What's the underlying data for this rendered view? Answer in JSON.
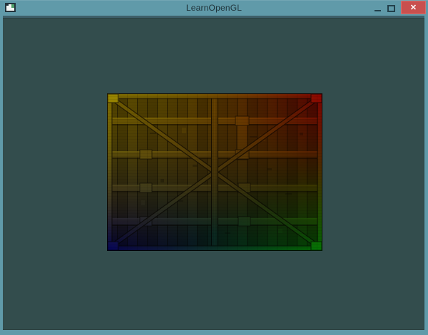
{
  "window": {
    "title": "LearnOpenGL",
    "icons": {
      "app": "app-window-icon",
      "minimize": "minimize-icon",
      "maximize": "maximize-icon",
      "close": "close-icon"
    },
    "controls": {
      "close_glyph": "✕"
    }
  },
  "colors": {
    "titlebar": "#609aa9",
    "window_border": "#609aa9",
    "titlebar_text": "#21363d",
    "close_button": "#c9504e",
    "viewport_clear_color": "#334d4d"
  },
  "scene": {
    "object": "textured-wooden-container-quad",
    "texture": "wooden-container",
    "vertex_corner_colors": {
      "top_left": "#ffff00",
      "top_right": "#ff0000",
      "bottom_left": "#0000ff",
      "bottom_right": "#00ff00"
    }
  }
}
